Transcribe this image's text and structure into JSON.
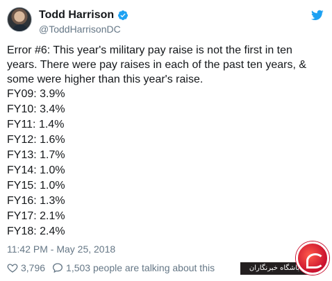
{
  "tweet": {
    "display_name": "Todd Harrison",
    "handle": "@ToddHarrisonDC",
    "text": "Error #6: This year's military pay raise is not the first in ten years. There were pay raises in each of the past ten years, & some were higher than this year's raise.",
    "pay_raises": [
      "FY09: 3.9%",
      "FY10: 3.4%",
      "FY11: 1.4%",
      "FY12: 1.6%",
      "FY13: 1.7%",
      "FY14: 1.0%",
      "FY15: 1.0%",
      "FY16: 1.3%",
      "FY17: 2.1%",
      "FY18: 2.4%"
    ],
    "timestamp": "11:42 PM - May 25, 2018",
    "likes": "3,796",
    "replies_text": "1,503 people are talking about this"
  },
  "watermark": {
    "text": "باشگاه خبرنگاران"
  },
  "colors": {
    "twitter_blue": "#1da1f2",
    "secondary_text": "#657786",
    "primary_text": "#14171a"
  },
  "icons": {
    "verified": "verified-badge-icon",
    "bird": "twitter-bird-icon",
    "like": "heart-icon",
    "reply": "reply-bubble-icon"
  }
}
